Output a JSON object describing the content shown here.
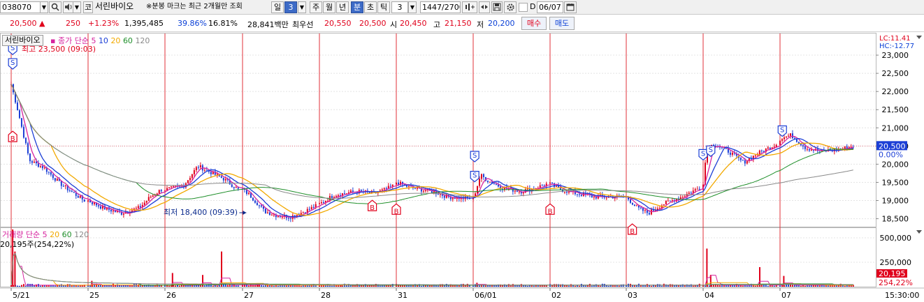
{
  "toolbar": {
    "stock_code": "038070",
    "market_label": "코",
    "stock_name": "서린바이오",
    "notice": "※분봉 마크는 최근 2개월만 조회",
    "period_day": "일",
    "period_num": "3",
    "period_week": "주",
    "period_month": "월",
    "period_year": "년",
    "period_minute": "분",
    "period_second": "초",
    "period_tick": "틱",
    "interval_value": "3",
    "count_display": "1447/2700",
    "checkbox_d_label": "D",
    "date_value": "06/07"
  },
  "quote": {
    "price": "20,500",
    "change_arrow": "▲",
    "change": "250",
    "change_pct": "+1.23%",
    "volume": "1,395,485",
    "volume_ratio": "39.86%",
    "turnover_ratio": "16.81%",
    "amount": "28,841백만",
    "best_ask_label": "최우선",
    "best_ask": "20,550",
    "best_bid": "20,500",
    "open_label": "시",
    "open": "20,450",
    "high_label": "고",
    "high": "21,150",
    "low_label": "저",
    "low": "20,200",
    "buy_label": "매수",
    "sell_label": "매도"
  },
  "price_panel": {
    "name_tab": "서린바이오",
    "legend_prefix": "종가 단순",
    "ma_periods": [
      "5",
      "10",
      "20",
      "60",
      "120"
    ],
    "ma_colors": [
      "#d6249f",
      "#1c3fd6",
      "#f2a900",
      "#1f8f2a",
      "#8a8a8a"
    ],
    "lc_label": "LC:11.41",
    "hc_label": "HC:-12.77",
    "y_ticks": [
      "23,000",
      "22,500",
      "22,000",
      "21,500",
      "21,000",
      "20,500",
      "20,000",
      "19,500",
      "19,000",
      "18,500"
    ],
    "current_price_tag": "20,500",
    "current_pct_tag": "0.00%",
    "high_annotation": "최고 23,500 (09:03)",
    "low_annotation": "최저 18,400 (09:39)",
    "signal_s": "S",
    "signal_b": "B"
  },
  "volume_panel": {
    "legend_name": "거래량",
    "legend_prefix": "단순",
    "ma_periods": [
      "5",
      "20",
      "60",
      "120"
    ],
    "current_volume": "20,195주(254,22%)",
    "y_ticks": [
      "500,000",
      "250,000"
    ],
    "volume_tag": "20,195",
    "volume_pct_tag": "254,22%"
  },
  "x_axis": {
    "labels": [
      "5/21",
      "25",
      "26",
      "27",
      "28",
      "31",
      "06/01",
      "02",
      "03",
      "04",
      "07"
    ],
    "end_time": "15:30:00"
  },
  "chart_data": {
    "type": "candlestick",
    "price_range": [
      18300,
      23500
    ],
    "sessions": [
      "5/21",
      "25",
      "26",
      "27",
      "28",
      "31",
      "06/01",
      "02",
      "03",
      "04",
      "07"
    ],
    "session_price_path": [
      [
        [
          0,
          22200
        ],
        [
          0.1,
          21400
        ],
        [
          0.25,
          20100
        ],
        [
          0.45,
          19900
        ],
        [
          0.65,
          19500
        ],
        [
          0.85,
          19200
        ],
        [
          1,
          19000
        ]
      ],
      [
        [
          0,
          19000
        ],
        [
          0.2,
          18800
        ],
        [
          0.45,
          18650
        ],
        [
          0.7,
          18800
        ],
        [
          0.85,
          19100
        ],
        [
          1,
          19300
        ]
      ],
      [
        [
          0,
          19300
        ],
        [
          0.25,
          19400
        ],
        [
          0.45,
          19950
        ],
        [
          0.6,
          19800
        ],
        [
          0.8,
          19600
        ],
        [
          1,
          19300
        ]
      ],
      [
        [
          0,
          19300
        ],
        [
          0.1,
          19150
        ],
        [
          0.3,
          18700
        ],
        [
          0.45,
          18600
        ],
        [
          0.65,
          18550
        ],
        [
          0.85,
          18700
        ],
        [
          1,
          18850
        ]
      ],
      [
        [
          0,
          18900
        ],
        [
          0.2,
          19150
        ],
        [
          0.5,
          19250
        ],
        [
          0.75,
          19200
        ],
        [
          0.9,
          19300
        ],
        [
          1,
          19400
        ]
      ],
      [
        [
          0,
          19500
        ],
        [
          0.2,
          19350
        ],
        [
          0.5,
          19250
        ],
        [
          0.7,
          19100
        ],
        [
          1,
          19050
        ]
      ],
      [
        [
          0,
          19050
        ],
        [
          0.1,
          19700
        ],
        [
          0.2,
          19550
        ],
        [
          0.4,
          19350
        ],
        [
          0.65,
          19250
        ],
        [
          0.85,
          19350
        ],
        [
          1,
          19450
        ]
      ],
      [
        [
          0,
          19450
        ],
        [
          0.15,
          19300
        ],
        [
          0.35,
          19200
        ],
        [
          0.6,
          19100
        ],
        [
          1,
          19100
        ]
      ],
      [
        [
          0,
          19100
        ],
        [
          0.15,
          18800
        ],
        [
          0.3,
          18650
        ],
        [
          0.5,
          18900
        ],
        [
          0.75,
          19100
        ],
        [
          0.9,
          19250
        ],
        [
          1,
          19350
        ]
      ],
      [
        [
          0,
          19500
        ],
        [
          0.05,
          20450
        ],
        [
          0.15,
          20550
        ],
        [
          0.35,
          20350
        ],
        [
          0.55,
          20050
        ],
        [
          0.75,
          20300
        ],
        [
          1,
          20550
        ]
      ],
      [
        [
          0,
          20700
        ],
        [
          0.15,
          20800
        ],
        [
          0.35,
          20450
        ],
        [
          0.55,
          20350
        ],
        [
          0.8,
          20400
        ],
        [
          1,
          20500
        ]
      ]
    ],
    "extremes": {
      "high": 23500,
      "high_time": "09:03",
      "low": 18400,
      "low_time": "09:39"
    },
    "volume_range": [
      0,
      600000
    ],
    "volume_spikes": [
      {
        "session": 0,
        "pos": 0.02,
        "value": 610000
      },
      {
        "session": 0,
        "pos": 0.05,
        "value": 360000
      },
      {
        "session": 1,
        "pos": 0.05,
        "value": 60000
      },
      {
        "session": 2,
        "pos": 0.1,
        "value": 140000
      },
      {
        "session": 2,
        "pos": 0.75,
        "value": 360000
      },
      {
        "session": 2,
        "pos": 0.5,
        "value": 120000
      },
      {
        "session": 3,
        "pos": 0.2,
        "value": 30000
      },
      {
        "session": 4,
        "pos": 0.3,
        "value": 25000
      },
      {
        "session": 6,
        "pos": 0.05,
        "value": 40000
      },
      {
        "session": 9,
        "pos": 0.05,
        "value": 390000
      },
      {
        "session": 9,
        "pos": 0.1,
        "value": 120000
      },
      {
        "session": 9,
        "pos": 0.75,
        "value": 200000
      },
      {
        "session": 10,
        "pos": 0.05,
        "value": 110000
      }
    ],
    "signals": [
      {
        "type": "S",
        "session": 0,
        "pos": 0.02,
        "price": 23150
      },
      {
        "type": "S",
        "session": 0,
        "pos": 0.02,
        "price": 22750
      },
      {
        "type": "B",
        "session": 0,
        "pos": 0.02,
        "price": 20850
      },
      {
        "type": "B",
        "session": 4,
        "pos": 0.7,
        "price": 18950
      },
      {
        "type": "B",
        "session": 5,
        "pos": 0.0,
        "price": 18850
      },
      {
        "type": "S",
        "session": 6,
        "pos": 0.02,
        "price": 20200
      },
      {
        "type": "S",
        "session": 6,
        "pos": 0.02,
        "price": 19650
      },
      {
        "type": "B",
        "session": 7,
        "pos": 0.0,
        "price": 18850
      },
      {
        "type": "B",
        "session": 8,
        "pos": 0.08,
        "price": 18300
      },
      {
        "type": "S",
        "session": 9,
        "pos": 0.0,
        "price": 20250
      },
      {
        "type": "S",
        "session": 9,
        "pos": 0.1,
        "price": 20350
      },
      {
        "type": "S",
        "session": 10,
        "pos": 0.03,
        "price": 20900
      }
    ]
  }
}
